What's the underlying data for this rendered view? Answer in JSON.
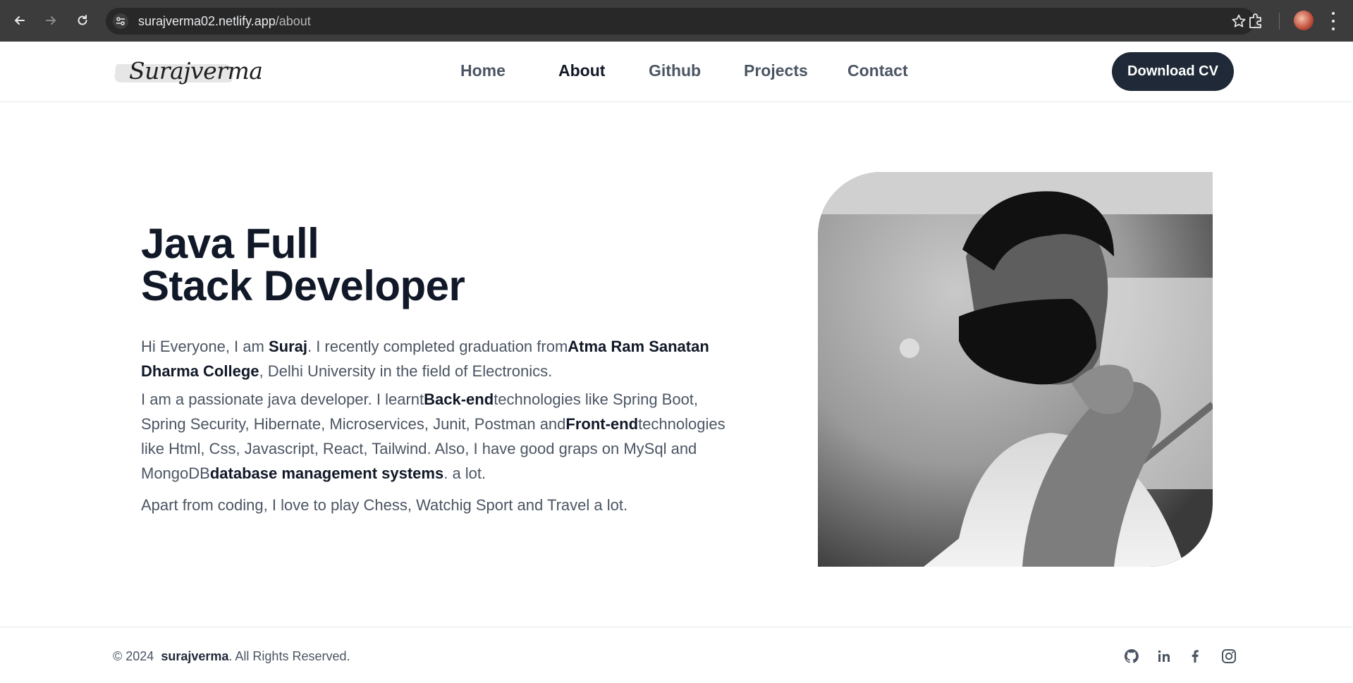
{
  "browser": {
    "url_host": "surajverma02.netlify.app",
    "url_path": "/about"
  },
  "header": {
    "logo_text": "Surajverma",
    "nav": [
      "Home",
      "About",
      "Github",
      "Projects",
      "Contact"
    ],
    "active_nav": "About",
    "cta_label": "Download CV"
  },
  "about": {
    "headline_line1": "Java Full",
    "headline_line2": "Stack Developer",
    "p1": {
      "t1": "Hi Everyone, I am ",
      "b1": "Suraj",
      "t2": ". I recently completed graduation from",
      "b2": "Atma Ram Sanatan Dharma College",
      "t3": ", Delhi University in the field of Electronics."
    },
    "p2": {
      "t1": "I am a passionate java developer. I learnt",
      "b1": "Back-end",
      "t2": "technologies like Spring Boot, Spring Security, Hibernate, Microservices, Junit, Postman and",
      "b2": "Front-end",
      "t3": "technologies like Html, Css, Javascript, React, Tailwind. Also, I have good graps on MySql and MongoDB",
      "b3": "database management systems",
      "t4": ". a lot."
    },
    "p3": "Apart from coding, I love to play Chess, Watchig Sport and Travel a lot."
  },
  "footer": {
    "copy_prefix": "© 2024",
    "owner": "surajverma",
    "copy_suffix": ". All Rights Reserved.",
    "social_icons": [
      "github-icon",
      "linkedin-icon",
      "facebook-icon",
      "instagram-icon"
    ]
  },
  "colors": {
    "brand_dark": "#1f2937",
    "text_muted": "#4b5563",
    "chrome_bg": "#3c3c3c"
  }
}
